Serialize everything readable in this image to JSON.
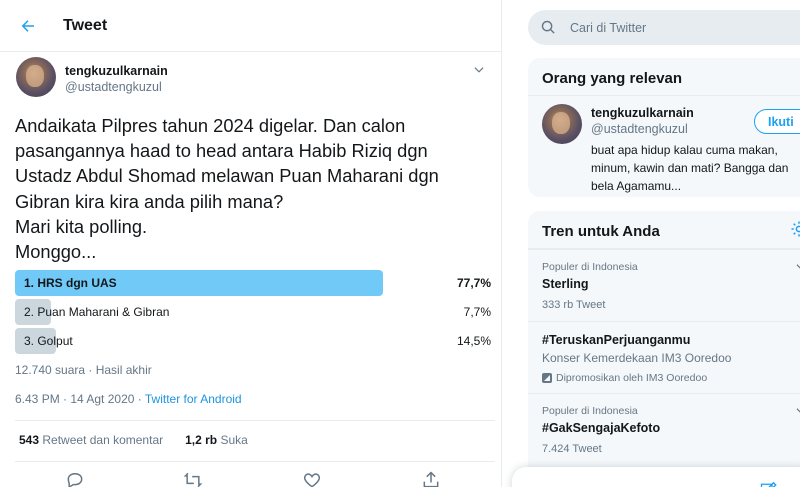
{
  "header": {
    "title": "Tweet",
    "back_icon": "back-arrow-icon"
  },
  "tweet": {
    "author_name": "tengkuzulkarnain",
    "author_handle": "@ustadtengkuzul",
    "text_lines": [
      "Andaikata Pilpres tahun 2024 digelar. Dan calon",
      "pasangannya haad to head antara Habib Riziq dgn",
      "Ustadz Abdul Shomad melawan Puan Maharani dgn",
      "Gibran kira kira anda pilih mana?",
      "Mari kita polling.",
      "Monggo..."
    ],
    "poll": {
      "options": [
        {
          "label": "1. HRS dgn UAS",
          "percent_text": "77,7%",
          "share": 0.777,
          "winner": true
        },
        {
          "label": "2. Puan Maharani & Gibran",
          "percent_text": "7,7%",
          "share": 0.077,
          "winner": false
        },
        {
          "label": "3. Golput",
          "percent_text": "14,5%",
          "share": 0.145,
          "winner": false
        }
      ],
      "meta": "12.740 suara · Hasil akhir"
    },
    "timestamp": "6.43 PM · 14 Agt 2020",
    "separator": " · ",
    "source": "Twitter for Android",
    "retweets_count": "543",
    "retweets_label": "Retweet dan komentar",
    "likes_count": "1,2 rb",
    "likes_label": "Suka"
  },
  "search": {
    "placeholder": "Cari di Twitter"
  },
  "relevant": {
    "title": "Orang yang relevan",
    "name": "tengkuzulkarnain",
    "handle": "@ustadtengkuzul",
    "follow_label": "Ikuti",
    "bio_lines": [
      "buat apa hidup kalau cuma makan,",
      "minum, kawin dan mati? Bangga dan",
      "bela Agamamu..."
    ]
  },
  "trends": {
    "title": "Tren untuk Anda",
    "items": [
      {
        "context": "Populer di Indonesia",
        "name": "Sterling",
        "count": "333 rb Tweet"
      },
      {
        "name": "#TeruskanPerjuanganmu",
        "desc": "Konser Kemerdekaan IM3 Ooredoo",
        "promo": "Dipromosikan oleh IM3 Ooredoo"
      },
      {
        "context": "Populer di Indonesia",
        "name": "#GakSengajaKefoto",
        "count": "7.424 Tweet"
      }
    ]
  },
  "colors": {
    "accent": "#1da1f2",
    "poll_winner": "#71c9f8",
    "poll_other": "#ccd6dd",
    "muted": "#657786"
  }
}
